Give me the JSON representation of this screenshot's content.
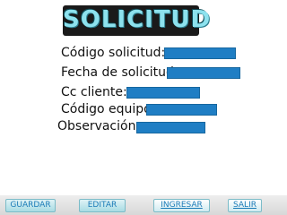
{
  "header": {
    "title": "SOLICITUD"
  },
  "form": {
    "codigo_solicitud_label": "Código solicitud:",
    "fecha_solicitud_label": "Fecha de solicitud",
    "cc_cliente_label": "Cc cliente:",
    "codigo_equipo_label": "Código equipo:",
    "observacion_label": "Observación:"
  },
  "toolbar": {
    "guardar_label": "GUARDAR",
    "editar_label": "EDITAR",
    "ingresar_label": "INGRESAR",
    "salir_label": "SALIR"
  },
  "colors": {
    "field_fill": "#1f7ec4",
    "title_text": "#8de2ee",
    "title_bg": "#1a1a1a",
    "button_text": "#1c7cb8"
  }
}
